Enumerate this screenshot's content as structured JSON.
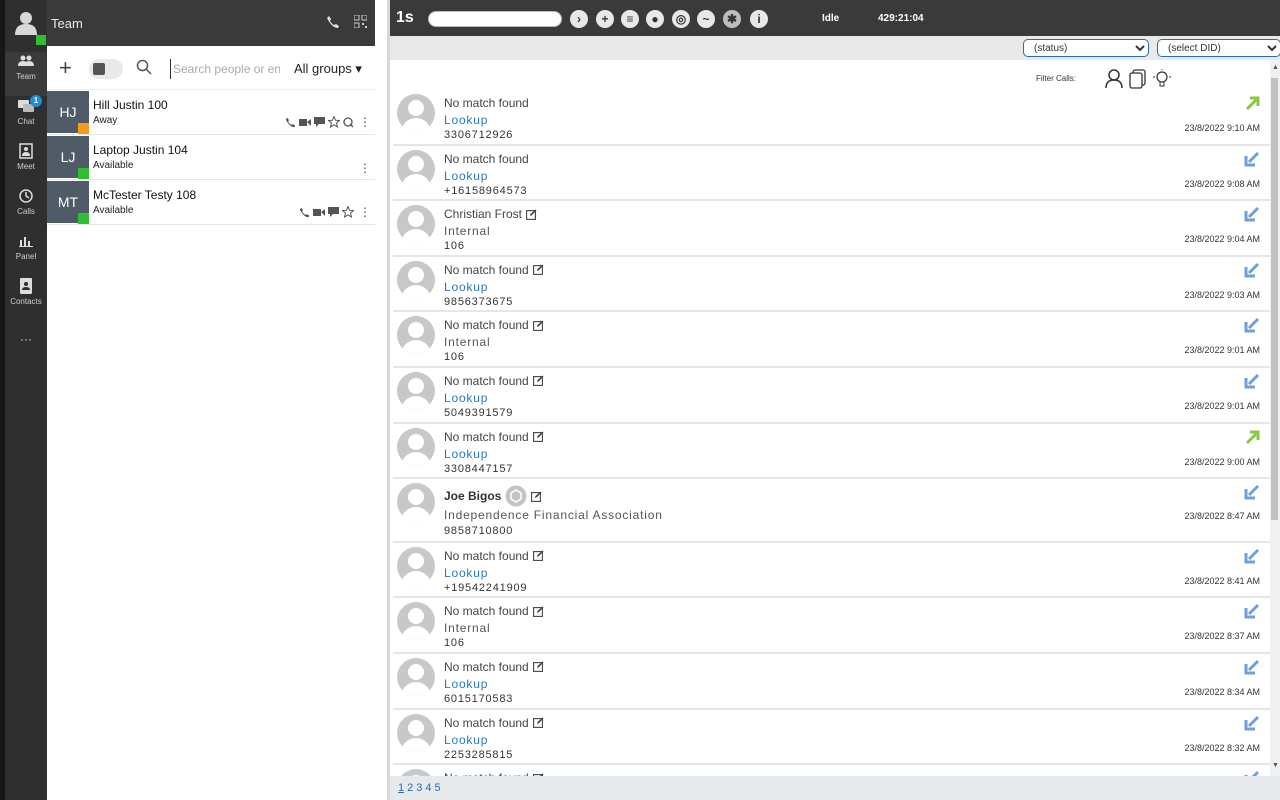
{
  "rail": {
    "items": [
      {
        "label": "Team",
        "icon": "team-icon"
      },
      {
        "label": "Chat",
        "icon": "chat-icon",
        "badge": "1"
      },
      {
        "label": "Meet",
        "icon": "meet-icon"
      },
      {
        "label": "Calls",
        "icon": "calls-history-icon"
      },
      {
        "label": "Panel",
        "icon": "panel-chart-icon"
      },
      {
        "label": "Contacts",
        "icon": "contacts-icon"
      },
      {
        "label": "···",
        "icon": "more-icon"
      }
    ]
  },
  "team": {
    "title": "Team",
    "search_placeholder": "Search people or en",
    "groups_label": "All groups",
    "people": [
      {
        "initials": "HJ",
        "name": "Hill Justin 100",
        "status": "Away",
        "status_color": "#f59a1b"
      },
      {
        "initials": "LJ",
        "name": "Laptop Justin 104",
        "status": "Available",
        "status_color": "#2fbf2f"
      },
      {
        "initials": "MT",
        "name": "McTester Testy 108",
        "status": "Available",
        "status_color": "#2fbf2f"
      }
    ]
  },
  "topbar": {
    "logo": "1s",
    "state": "Idle",
    "timer": "429:21:04"
  },
  "filters": {
    "status_select": "(status)",
    "did_select": "(select DID)",
    "filter_calls_label": "Filter Calls:"
  },
  "calls": [
    {
      "name": "No match found",
      "edit": false,
      "sub": "Lookup",
      "sub_link": true,
      "number": "3306712926",
      "time": "23/8/2022 9:10 AM",
      "direction": "outgoing"
    },
    {
      "name": "No match found",
      "edit": false,
      "sub": "Lookup",
      "sub_link": true,
      "number": "+16158964573",
      "time": "23/8/2022 9:08 AM",
      "direction": "incoming"
    },
    {
      "name": "Christian Frost",
      "edit": true,
      "sub": "Internal",
      "sub_link": false,
      "number": "106",
      "time": "23/8/2022 9:04 AM",
      "direction": "incoming"
    },
    {
      "name": "No match found",
      "edit": true,
      "sub": "Lookup",
      "sub_link": true,
      "number": "9856373675",
      "time": "23/8/2022 9:03 AM",
      "direction": "incoming"
    },
    {
      "name": "No match found",
      "edit": true,
      "sub": "Internal",
      "sub_link": false,
      "number": "106",
      "time": "23/8/2022 9:01 AM",
      "direction": "incoming"
    },
    {
      "name": "No match found",
      "edit": true,
      "sub": "Lookup",
      "sub_link": true,
      "number": "5049391579",
      "time": "23/8/2022 9:01 AM",
      "direction": "incoming"
    },
    {
      "name": "No match found",
      "edit": true,
      "sub": "Lookup",
      "sub_link": true,
      "number": "3308447157",
      "time": "23/8/2022 9:00 AM",
      "direction": "outgoing"
    },
    {
      "name": "Joe Bigos",
      "edit": true,
      "bold": true,
      "badge": true,
      "sub": "Independence Financial Association",
      "sub_link": false,
      "number": "9858710800",
      "time": "23/8/2022 8:47 AM",
      "direction": "incoming"
    },
    {
      "name": "No match found",
      "edit": true,
      "sub": "Lookup",
      "sub_link": true,
      "number": "+19542241909",
      "time": "23/8/2022 8:41 AM",
      "direction": "incoming"
    },
    {
      "name": "No match found",
      "edit": true,
      "sub": "Internal",
      "sub_link": false,
      "number": "106",
      "time": "23/8/2022 8:37 AM",
      "direction": "incoming"
    },
    {
      "name": "No match found",
      "edit": true,
      "sub": "Lookup",
      "sub_link": true,
      "number": "6015170583",
      "time": "23/8/2022 8:34 AM",
      "direction": "incoming"
    },
    {
      "name": "No match found",
      "edit": true,
      "sub": "Lookup",
      "sub_link": true,
      "number": "2253285815",
      "time": "23/8/2022 8:32 AM",
      "direction": "incoming"
    },
    {
      "name": "No match found",
      "edit": true,
      "sub": "",
      "sub_link": false,
      "number": "",
      "time": "",
      "direction": "incoming"
    }
  ],
  "pager": [
    "1",
    "2",
    "3",
    "4",
    "5"
  ],
  "colors": {
    "outgoing": "#8cc63f",
    "incoming": "#6f9fd8",
    "link": "#2a78bd"
  }
}
